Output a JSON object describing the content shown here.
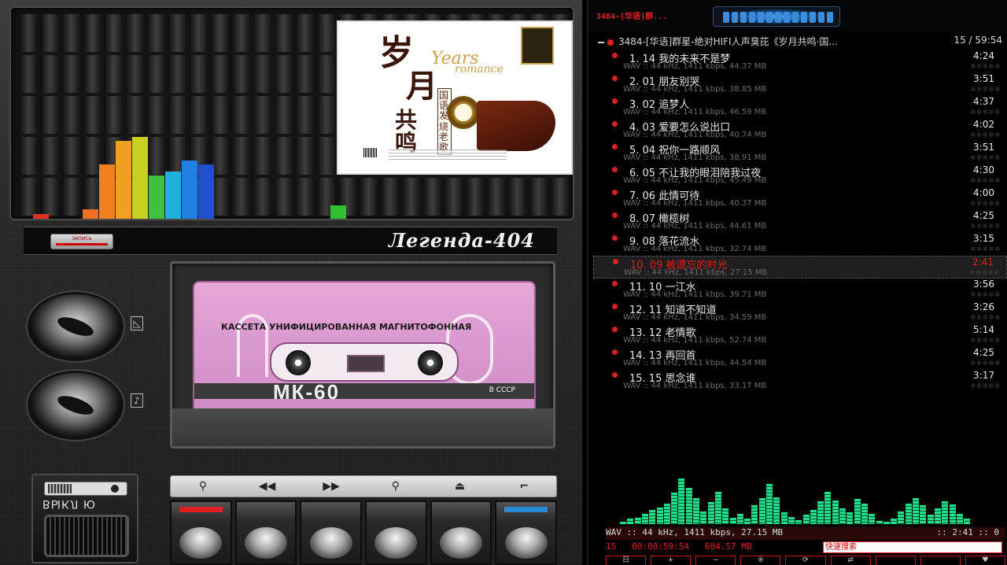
{
  "deck": {
    "brand": "Легенда-404",
    "zapis_label": "ЗАПИСЬ",
    "switch_label": "ВЫКЛ Ю",
    "cassette": {
      "label": "КАССЕТА УНИФИЦИРОВАННАЯ МАГНИТОФОННАЯ",
      "brand": "МК-60",
      "made_in": "В СССР"
    },
    "album": {
      "title_line1": "岁",
      "title_line2": "月",
      "title_line3": "共鸣",
      "english_1": "Years",
      "english_2": "romance",
      "subtitle": "国语发烧老歌"
    },
    "knob_icons": [
      "volume-icon",
      "tone-icon"
    ],
    "transport": [
      "⚲",
      "◀◀",
      "▶▶",
      "⚲",
      "⏏",
      "⌐"
    ],
    "keys": [
      {
        "indicator": "#e02020"
      },
      {
        "indicator": ""
      },
      {
        "indicator": ""
      },
      {
        "indicator": ""
      },
      {
        "indicator": ""
      },
      {
        "indicator": "#2a8ad8"
      }
    ],
    "spectrum": [
      {
        "value": 0.02,
        "color": "#e03020"
      },
      {
        "value": 0.0,
        "color": "#e03020"
      },
      {
        "value": 0.0,
        "color": "#e03020"
      },
      {
        "value": 0.05,
        "color": "#f07020"
      },
      {
        "value": 0.28,
        "color": "#f08020"
      },
      {
        "value": 0.4,
        "color": "#f0a020"
      },
      {
        "value": 0.42,
        "color": "#c8d020"
      },
      {
        "value": 0.22,
        "color": "#40c040"
      },
      {
        "value": 0.24,
        "color": "#20b0e0"
      },
      {
        "value": 0.3,
        "color": "#2080e0"
      },
      {
        "value": 0.28,
        "color": "#2050d0"
      },
      {
        "value": 0.0,
        "color": "#2050d0"
      },
      {
        "value": 0.0,
        "color": "#2050d0"
      },
      {
        "value": 0.0,
        "color": "#2050d0"
      },
      {
        "value": 0.0,
        "color": "#2050d0"
      },
      {
        "value": 0.0,
        "color": "#2050d0"
      },
      {
        "value": 0.0,
        "color": "#2050d0"
      },
      {
        "value": 0.0,
        "color": "#2050d0"
      },
      {
        "value": 0.07,
        "color": "#30c030"
      }
    ]
  },
  "playlist": {
    "title": "3484-[华语]群...",
    "header": "3484-[华语]群星-绝对HIFI人声臭芘《岁月共鸣·国...",
    "count": "15 / 59:54",
    "tracks": [
      {
        "name": "1. 14 我的未来不是梦",
        "meta": "WAV :: 44 kHz, 1411 kbps, 44.37 MB",
        "dur": "4:24",
        "active": false
      },
      {
        "name": "2. 01 朋友别哭",
        "meta": "WAV :: 44 kHz, 1411 kbps, 38.85 MB",
        "dur": "3:51",
        "active": false
      },
      {
        "name": "3. 02 追梦人",
        "meta": "WAV :: 44 kHz, 1411 kbps, 46.59 MB",
        "dur": "4:37",
        "active": false
      },
      {
        "name": "4. 03 爱要怎么说出口",
        "meta": "WAV :: 44 kHz, 1411 kbps, 40.74 MB",
        "dur": "4:02",
        "active": false
      },
      {
        "name": "5. 04 祝你一路顺风",
        "meta": "WAV :: 44 kHz, 1411 kbps, 38.91 MB",
        "dur": "3:51",
        "active": false
      },
      {
        "name": "6. 05 不让我的眼泪陪我过夜",
        "meta": "WAV :: 44 kHz, 1411 kbps, 45.49 MB",
        "dur": "4:30",
        "active": false
      },
      {
        "name": "7. 06 此情可待",
        "meta": "WAV :: 44 kHz, 1411 kbps, 40.37 MB",
        "dur": "4:00",
        "active": false
      },
      {
        "name": "8. 07 橄榄树",
        "meta": "WAV :: 44 kHz, 1411 kbps, 44.61 MB",
        "dur": "4:25",
        "active": false
      },
      {
        "name": "9. 08 落花流水",
        "meta": "WAV :: 44 kHz, 1411 kbps, 32.74 MB",
        "dur": "3:15",
        "active": false
      },
      {
        "name": "10. 09 被遗忘的时光",
        "meta": "WAV :: 44 kHz, 1411 kbps, 27.15 MB",
        "dur": "2:41",
        "active": true
      },
      {
        "name": "11. 10 一江水",
        "meta": "WAV :: 44 kHz, 1411 kbps, 39.71 MB",
        "dur": "3:56",
        "active": false
      },
      {
        "name": "12. 11 知道不知道",
        "meta": "WAV :: 44 kHz, 1411 kbps, 34.59 MB",
        "dur": "3:26",
        "active": false
      },
      {
        "name": "13. 12 老情歌",
        "meta": "WAV :: 44 kHz, 1411 kbps, 52.74 MB",
        "dur": "5:14",
        "active": false
      },
      {
        "name": "14. 13 再回首",
        "meta": "WAV :: 44 kHz, 1411 kbps, 44.54 MB",
        "dur": "4:25",
        "active": false
      },
      {
        "name": "15. 15 思念谁",
        "meta": "WAV :: 44 kHz, 1411 kbps, 33.17 MB",
        "dur": "3:17",
        "active": false
      }
    ],
    "now_playing_info": "WAV :: 44 kHz, 1411 kbps, 27.15 MB",
    "now_playing_time": ":: 2:41 :: 0",
    "status_count": "15",
    "status_total": "00:00:59:54",
    "status_size": "604.57 MB",
    "search_placeholder": "快速搜索",
    "buttons": [
      "日",
      "+",
      "−",
      "※",
      "⟳",
      "⇄",
      "",
      "",
      "♥"
    ],
    "visualizer": [
      0.05,
      0.1,
      0.12,
      0.2,
      0.28,
      0.32,
      0.4,
      0.6,
      0.88,
      0.7,
      0.5,
      0.25,
      0.42,
      0.62,
      0.3,
      0.12,
      0.2,
      0.1,
      0.36,
      0.5,
      0.78,
      0.52,
      0.22,
      0.14,
      0.08,
      0.18,
      0.28,
      0.44,
      0.62,
      0.46,
      0.3,
      0.22,
      0.48,
      0.4,
      0.2,
      0.06,
      0.04,
      0.1,
      0.24,
      0.4,
      0.5,
      0.36,
      0.18,
      0.3,
      0.44,
      0.38,
      0.2,
      0.1
    ]
  }
}
